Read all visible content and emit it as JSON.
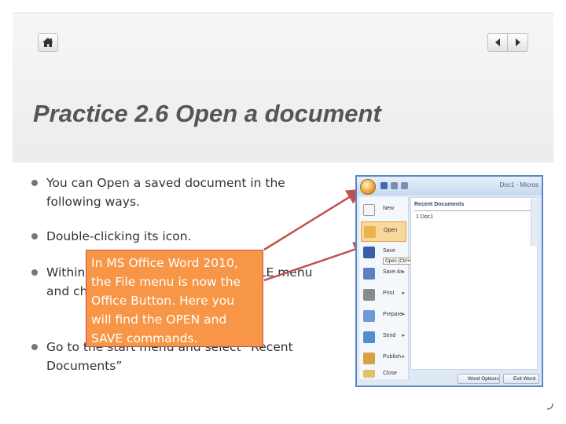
{
  "toolbar": {
    "home_icon": "home-icon",
    "back_icon": "triangle-left-icon",
    "forward_icon": "triangle-right-icon"
  },
  "title": "Practice 2.6 Open a document",
  "bullets": [
    {
      "text": "You can Open a saved document in the following ways."
    },
    {
      "text": "Double-clicking its icon."
    },
    {
      "text": "Within MS Office Word, go to the FILE menu and choose Open."
    },
    {
      "text": "Go to the start menu and select “Recent Documents”"
    }
  ],
  "callout": {
    "text": "In MS Office Word 2010, the File menu is now the Office Button. Here you will find the OPEN and SAVE commands."
  },
  "screenshot": {
    "window_title": "Doc1 - Micros",
    "recent_header": "Recent Documents",
    "recent_doc": "1  Doc1",
    "open_tooltip": "Open (Ctrl+O)",
    "menu_items": [
      {
        "label": "New",
        "has_arrow": false
      },
      {
        "label": "Open",
        "has_arrow": false
      },
      {
        "label": "Save",
        "has_arrow": false
      },
      {
        "label": "Save As",
        "has_arrow": true
      },
      {
        "label": "Print",
        "has_arrow": true
      },
      {
        "label": "Prepare",
        "has_arrow": true
      },
      {
        "label": "Send",
        "has_arrow": true
      },
      {
        "label": "Publish",
        "has_arrow": true
      },
      {
        "label": "Close",
        "has_arrow": false
      }
    ],
    "word_options": "Word Options",
    "exit_word": "Exit Word"
  },
  "colors": {
    "callout_fill": "#f79646",
    "arrow": "#c0504d",
    "title_text": "#555555"
  }
}
